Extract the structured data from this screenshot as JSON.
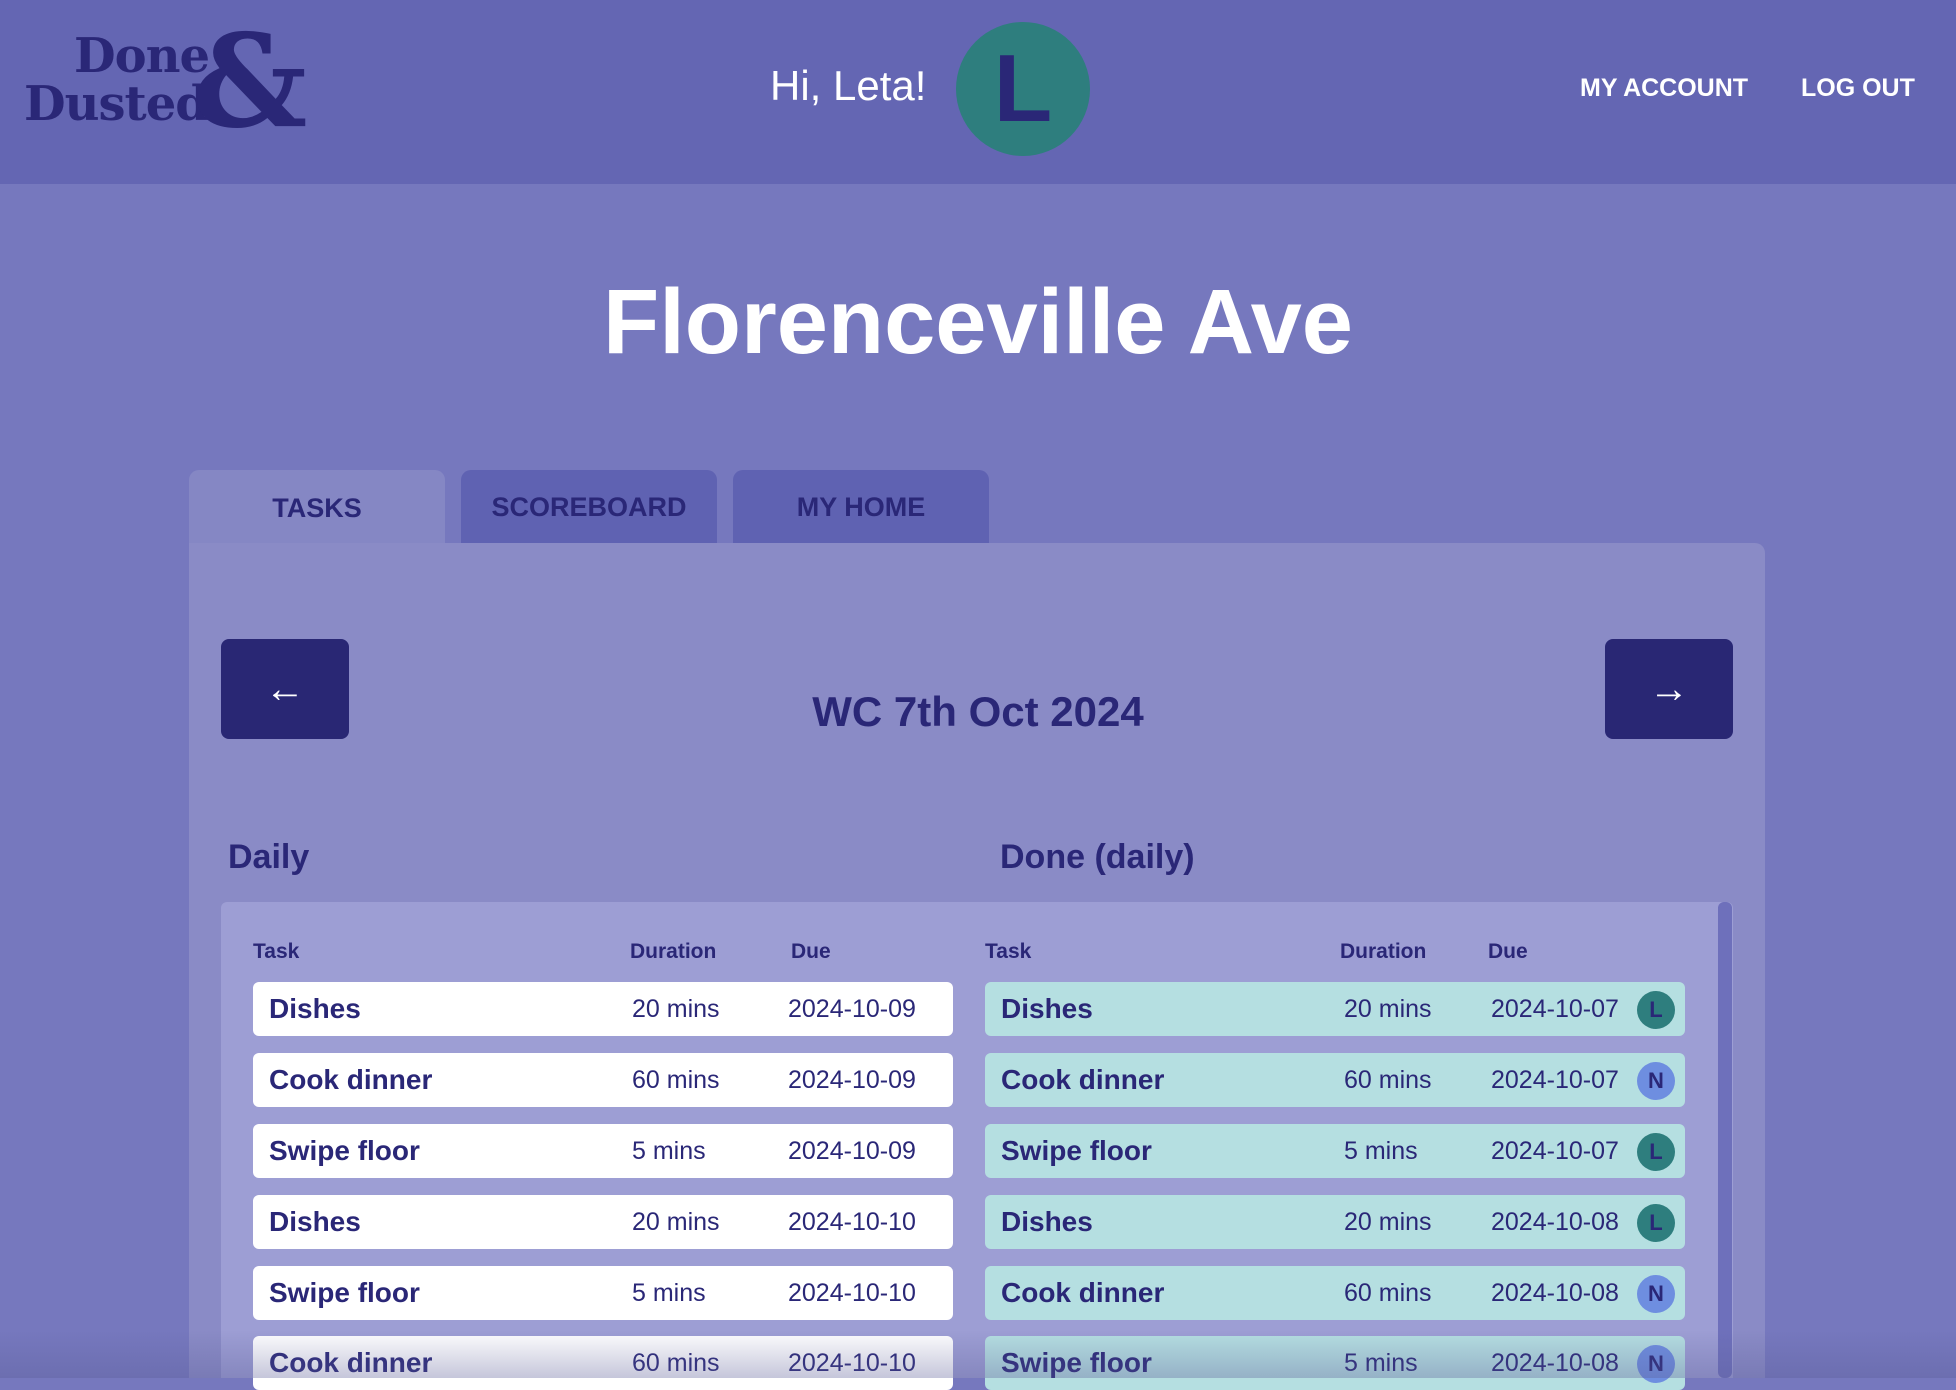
{
  "header": {
    "logo": {
      "line1": "Done",
      "line2": "Dusted",
      "amp": "&"
    },
    "greeting": "Hi, Leta!",
    "avatar_initial": "L",
    "nav": {
      "account": "MY ACCOUNT",
      "logout": "LOG OUT"
    }
  },
  "page_title": "Florenceville Ave",
  "tabs": [
    {
      "label": "TASKS",
      "active": true
    },
    {
      "label": "SCOREBOARD",
      "active": false
    },
    {
      "label": "MY HOME",
      "active": false
    }
  ],
  "week": {
    "label": "WC 7th Oct 2024",
    "prev_icon": "arrow-left-icon",
    "next_icon": "arrow-right-icon",
    "prev_glyph": "←",
    "next_glyph": "→"
  },
  "daily": {
    "title": "Daily",
    "columns": {
      "task": "Task",
      "duration": "Duration",
      "due": "Due"
    },
    "rows": [
      {
        "task": "Dishes",
        "duration": "20 mins",
        "due": "2024-10-09"
      },
      {
        "task": "Cook dinner",
        "duration": "60 mins",
        "due": "2024-10-09"
      },
      {
        "task": "Swipe floor",
        "duration": "5 mins",
        "due": "2024-10-09"
      },
      {
        "task": "Dishes",
        "duration": "20 mins",
        "due": "2024-10-10"
      },
      {
        "task": "Swipe floor",
        "duration": "5 mins",
        "due": "2024-10-10"
      },
      {
        "task": "Cook dinner",
        "duration": "60 mins",
        "due": "2024-10-10"
      }
    ]
  },
  "done_daily": {
    "title": "Done (daily)",
    "columns": {
      "task": "Task",
      "duration": "Duration",
      "due": "Due"
    },
    "rows": [
      {
        "task": "Dishes",
        "duration": "20 mins",
        "due": "2024-10-07",
        "user": "L"
      },
      {
        "task": "Cook dinner",
        "duration": "60 mins",
        "due": "2024-10-07",
        "user": "N"
      },
      {
        "task": "Swipe floor",
        "duration": "5 mins",
        "due": "2024-10-07",
        "user": "L"
      },
      {
        "task": "Dishes",
        "duration": "20 mins",
        "due": "2024-10-08",
        "user": "L"
      },
      {
        "task": "Cook dinner",
        "duration": "60 mins",
        "due": "2024-10-08",
        "user": "N"
      },
      {
        "task": "Swipe floor",
        "duration": "5 mins",
        "due": "2024-10-08",
        "user": "N"
      }
    ]
  },
  "colors": {
    "background": "#7678be",
    "header": "#6466b3",
    "dark_navy": "#292774",
    "avatar_L": "#2e7e7e",
    "avatar_N": "#6e8ee0",
    "done_row": "#b5dfe1"
  }
}
